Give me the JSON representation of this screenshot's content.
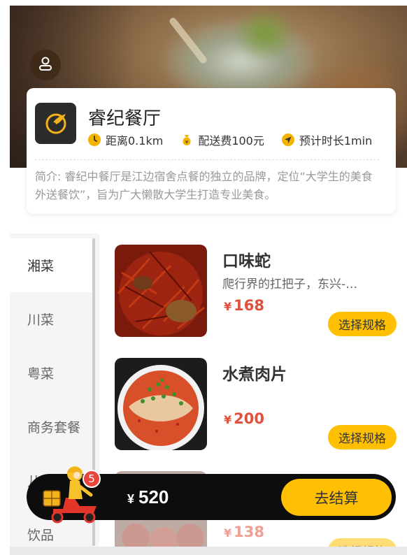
{
  "shop": {
    "name": "睿纪餐厅",
    "distance": "距离0.1km",
    "delivery_fee": "配送费100元",
    "eta": "预计时长1min",
    "description": "简介: 睿纪中餐厅是江边宿舍点餐的独立的品牌，定位“大学生的美食外送餐饮”，旨为广大懒散大学生打造专业美食。"
  },
  "categories": [
    {
      "label": "湘菜",
      "active": true
    },
    {
      "label": "川菜",
      "active": false
    },
    {
      "label": "粤菜",
      "active": false
    },
    {
      "label": "商务套餐",
      "active": false
    },
    {
      "label": "儿童套餐",
      "active": false
    },
    {
      "label": "饮品",
      "active": false
    }
  ],
  "dishes": [
    {
      "name": "口味蛇",
      "desc": "爬行界的扛把子，东兴-…",
      "price": "168",
      "currency": "¥",
      "spec_label": "选择规格"
    },
    {
      "name": "水煮肉片",
      "desc": "",
      "price": "200",
      "currency": "¥",
      "spec_label": "选择规格"
    },
    {
      "name": "",
      "desc": "",
      "price": "138",
      "currency": "¥",
      "spec_label": "选择规格"
    }
  ],
  "cart": {
    "badge_count": "5",
    "currency": "¥",
    "total": "520",
    "checkout_label": "去结算"
  },
  "colors": {
    "accent": "#ffc003",
    "price": "#e24f3b",
    "cart_bg": "#0d0d0d",
    "badge": "#e8453c"
  },
  "icons": [
    "user-icon",
    "shop-logo-icon",
    "clock-icon",
    "money-bag-icon",
    "navigation-arrow-icon",
    "delivery-rider-icon"
  ]
}
